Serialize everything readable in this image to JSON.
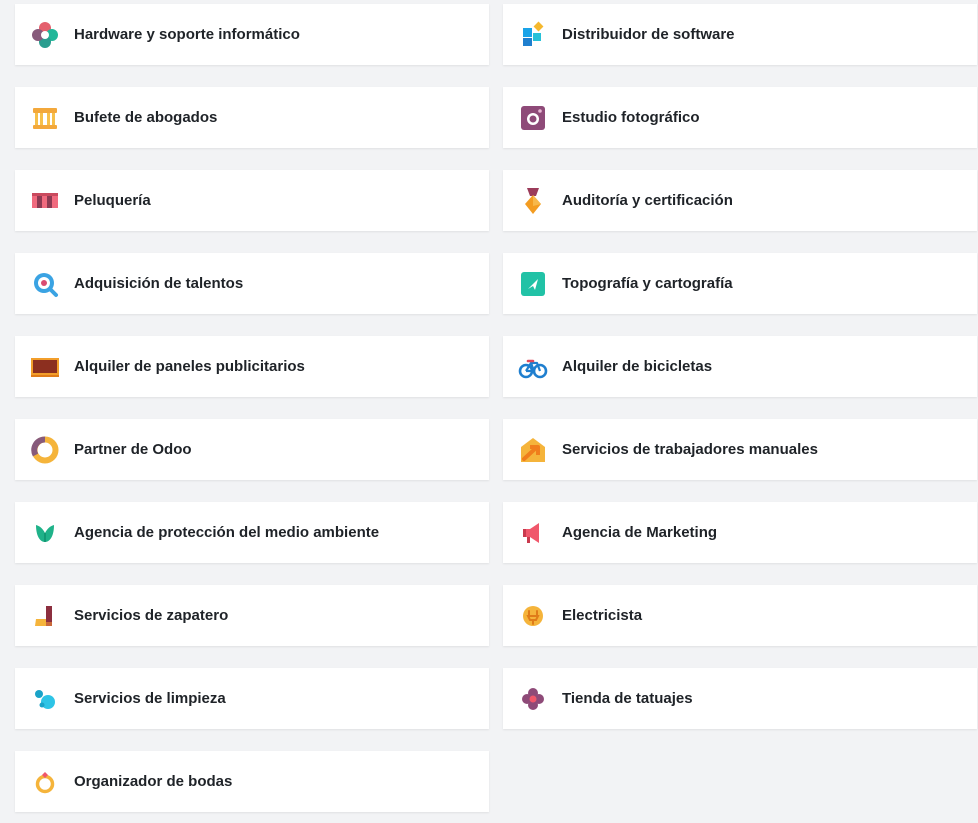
{
  "industries": [
    {
      "label": "Hardware y soporte informático",
      "icon": "flower-hardware-icon"
    },
    {
      "label": "Distribuidor de software",
      "icon": "software-blocks-icon"
    },
    {
      "label": "Bufete de abogados",
      "icon": "courthouse-icon"
    },
    {
      "label": "Estudio fotográfico",
      "icon": "camera-icon"
    },
    {
      "label": "Peluquería",
      "icon": "awning-shop-icon"
    },
    {
      "label": "Auditoría y certificación",
      "icon": "medal-icon"
    },
    {
      "label": "Adquisición de talentos",
      "icon": "magnifier-icon"
    },
    {
      "label": "Topografía y cartografía",
      "icon": "map-pin-icon"
    },
    {
      "label": "Alquiler de paneles publicitarios",
      "icon": "billboard-icon"
    },
    {
      "label": "Alquiler de bicicletas",
      "icon": "bicycle-icon"
    },
    {
      "label": "Partner de Odoo",
      "icon": "odoo-ring-icon"
    },
    {
      "label": "Servicios de trabajadores manuales",
      "icon": "house-arrow-icon"
    },
    {
      "label": "Agencia de protección del medio ambiente",
      "icon": "leaf-icon"
    },
    {
      "label": "Agencia de Marketing",
      "icon": "megaphone-icon"
    },
    {
      "label": "Servicios de zapatero",
      "icon": "boot-icon"
    },
    {
      "label": "Electricista",
      "icon": "plug-icon"
    },
    {
      "label": "Servicios de limpieza",
      "icon": "bubbles-icon"
    },
    {
      "label": "Tienda de tatuajes",
      "icon": "tattoo-flower-icon"
    },
    {
      "label": "Organizador de bodas",
      "icon": "ring-icon"
    }
  ]
}
